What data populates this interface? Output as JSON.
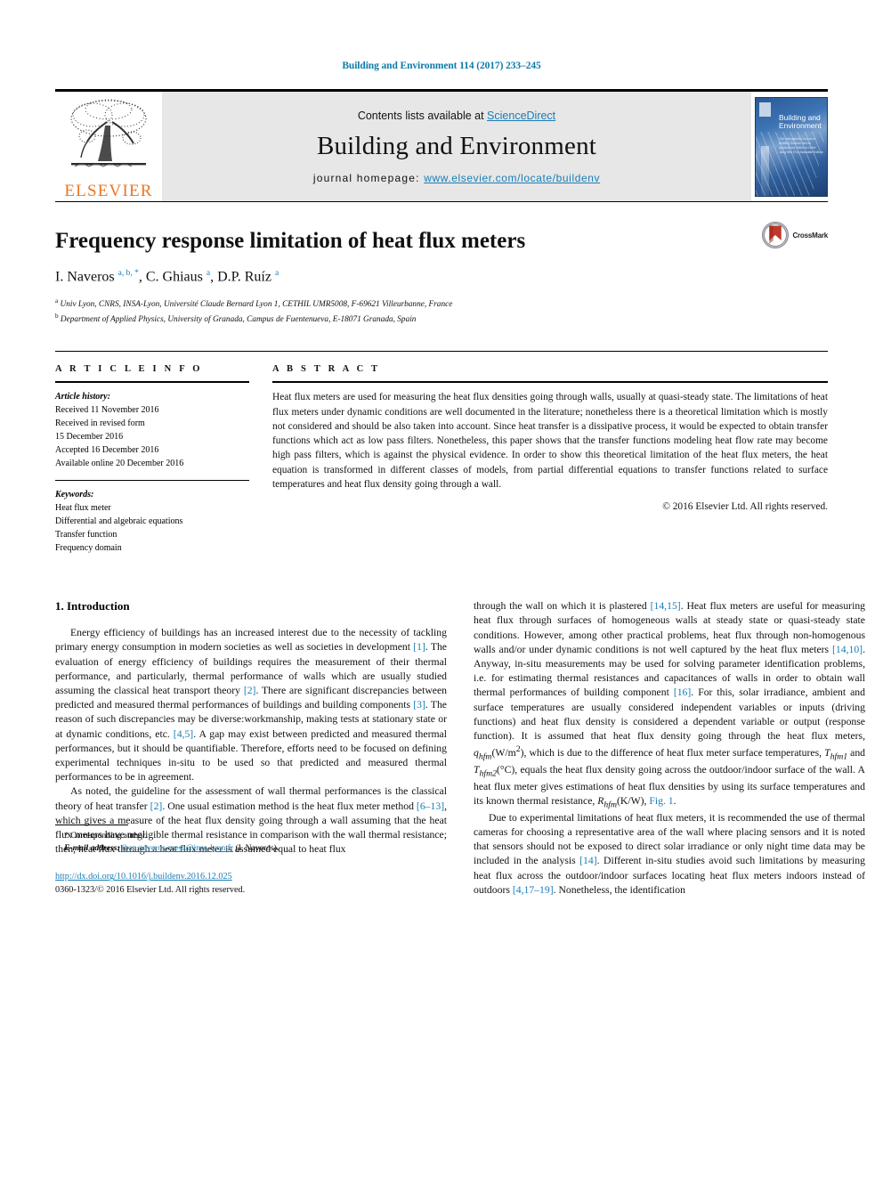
{
  "running_head": "Building and Environment 114 (2017) 233–245",
  "masthead": {
    "publisher_name": "ELSEVIER",
    "contents_prefix": "Contents lists available at ",
    "contents_link": "ScienceDirect",
    "journal_title": "Building and Environment",
    "homepage_label": "journal homepage: ",
    "homepage_url": "www.elsevier.com/locate/buildenv",
    "cover": {
      "title": "Building and Environment",
      "subtitle": "The International Journal of Building Science and its Applications\nEditor-in-Chief: Jiang Wei (Yiu)\nAssociate Editors"
    }
  },
  "article": {
    "title": "Frequency response limitation of heat flux meters",
    "authors_html": "I. Naveros <sup>a, b, *</sup>, C. Ghiaus <sup>a</sup>, D.P. Ruíz <sup>a</sup>",
    "affiliations": [
      "Univ Lyon, CNRS, INSA-Lyon, Université Claude Bernard Lyon 1, CETHIL UMR5008, F-69621 Villeurbanne, France",
      "Department of Applied Physics, University of Granada, Campus de Fuentenueva, E-18071 Granada, Spain"
    ],
    "affiliation_marks": [
      "a",
      "b"
    ],
    "crossmark_label": "CrossMark"
  },
  "info": {
    "heading": "A R T I C L E   I N F O",
    "history_label": "Article history:",
    "history": [
      "Received 11 November 2016",
      "Received in revised form",
      "15 December 2016",
      "Accepted 16 December 2016",
      "Available online 20 December 2016"
    ],
    "keywords_label": "Keywords:",
    "keywords": [
      "Heat flux meter",
      "Differential and algebraic equations",
      "Transfer function",
      "Frequency domain"
    ]
  },
  "abstract": {
    "heading": "A B S T R A C T",
    "text": "Heat flux meters are used for measuring the heat flux densities going through walls, usually at quasi-steady state. The limitations of heat flux meters under dynamic conditions are well documented in the literature; nonetheless there is a theoretical limitation which is mostly not considered and should be also taken into account. Since heat transfer is a dissipative process, it would be expected to obtain transfer functions which act as low pass filters. Nonetheless, this paper shows that the transfer functions modeling heat flow rate may become high pass filters, which is against the physical evidence. In order to show this theoretical limitation of the heat flux meters, the heat equation is transformed in different classes of models, from partial differential equations to transfer functions related to surface temperatures and heat flux density going through a wall.",
    "copyright": "© 2016 Elsevier Ltd. All rights reserved."
  },
  "body": {
    "section_title": "1. Introduction",
    "left_paragraphs_html": [
      "Energy efficiency of buildings has an increased interest due to the necessity of tackling primary energy consumption in modern societies as well as societies in development <span class=\"ref\">[1]</span>. The evaluation of energy efficiency of buildings requires the measurement of their thermal performance, and particularly, thermal performance of walls which are usually studied assuming the classical heat transport theory <span class=\"ref\">[2]</span>. There are significant discrepancies between predicted and measured thermal performances of buildings and building components <span class=\"ref\">[3]</span>. The reason of such discrepancies may be diverse:workmanship, making tests at stationary state or at dynamic conditions, etc. <span class=\"ref\">[4,5]</span>. A gap may exist between predicted and measured thermal performances, but it should be quantifiable. Therefore, efforts need to be focused on defining experimental techniques in-situ to be used so that predicted and measured thermal performances to be in agreement.",
      "As noted, the guideline for the assessment of wall thermal performances is the classical theory of heat transfer <span class=\"ref\">[2]</span>. One usual estimation method is the heat flux meter method <span class=\"ref\">[6–13]</span>, which gives a measure of the heat flux density going through a wall assuming that the heat flux meters have negligible thermal resistance in comparison with the wall thermal resistance; then, heat flux through a heat flux meter is assumed equal to heat flux"
    ],
    "right_paragraphs_html": [
      "through the wall on which it is plastered <span class=\"ref\">[14,15]</span>. Heat flux meters are useful for measuring heat flux through surfaces of homogeneous walls at steady state or quasi-steady state conditions. However, among other practical problems, heat flux through non-homogenous walls and/or under dynamic conditions is not well captured by the heat flux meters <span class=\"ref\">[14,10]</span>. Anyway, in-situ measurements may be used for solving parameter identification problems, i.e. for estimating thermal resistances and capacitances of walls in order to obtain wall thermal performances of building component <span class=\"ref\">[16]</span>. For this, solar irradiance, ambient and surface temperatures are usually considered independent variables or inputs (driving functions) and heat flux density is considered a dependent variable or output (response function). It is assumed that heat flux density going through the heat flux meters, <span class=\"ital\">q<sub>hfm</sub></span>(W/m<sup>2</sup>), which is due to the difference of heat flux meter surface temperatures, <span class=\"ital\">T<sub>hfm1</sub></span> and <span class=\"ital\">T<sub>hfm2</sub></span>(°C), equals the heat flux density going across the outdoor/indoor surface of the wall. A heat flux meter gives estimations of heat flux densities by using its surface temperatures and its known thermal resistance, <span class=\"ital\">R<sub>hfm</sub></span>(K/W), <span class=\"ref\">Fig. 1</span>.",
      "Due to experimental limitations of heat flux meters, it is recommended the use of thermal cameras for choosing a representative area of the wall where placing sensors and it is noted that sensors should not be exposed to direct solar irradiance or only night time data may be included in the analysis <span class=\"ref\">[14]</span>. Different in-situ studies avoid such limitations by measuring heat flux across the outdoor/indoor surfaces locating heat flux meters indoors instead of outdoors <span class=\"ref\">[4,17–19]</span>. Nonetheless, the identification"
    ]
  },
  "footnote": {
    "corresponding_marker": "*",
    "corresponding_text": "Corresponding author.",
    "email_label": "E-mail address:",
    "email": "iban.naveros-mesa@insa-lyon.fr",
    "email_owner": "(I. Naveros).",
    "doi": "http://dx.doi.org/10.1016/j.buildenv.2016.12.025",
    "issn_line": "0360-1323/© 2016 Elsevier Ltd. All rights reserved."
  },
  "colors": {
    "link": "#1a7db6",
    "elsevier_orange": "#e87722",
    "banner_gray": "#e7e7e7"
  }
}
